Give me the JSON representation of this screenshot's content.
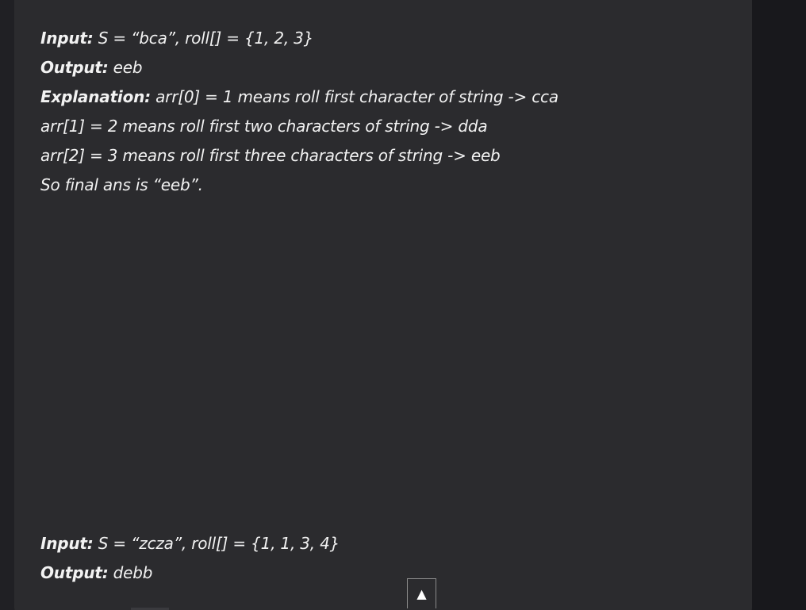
{
  "example1": {
    "input_label": "Input:",
    "input_value": " S = “bca”, roll[] = {1, 2, 3}",
    "output_label": "Output:",
    "output_value": " eeb",
    "explanation_label": "Explanation:",
    "explanation_lines": [
      " arr[0] = 1 means roll first character of string -> cca",
      "arr[1] = 2 means roll first two characters of string -> dda",
      "arr[2] = 3 means roll first three characters of string -> eeb",
      "So final ans is “eeb”."
    ]
  },
  "example2": {
    "input_label": "Input:",
    "input_value": " S = “zcza”, roll[] = {1, 1, 3, 4}",
    "output_label": "Output:",
    "output_value": " debb"
  },
  "scroll_top": {
    "icon": "arrow-up-icon",
    "glyph": "▲"
  }
}
